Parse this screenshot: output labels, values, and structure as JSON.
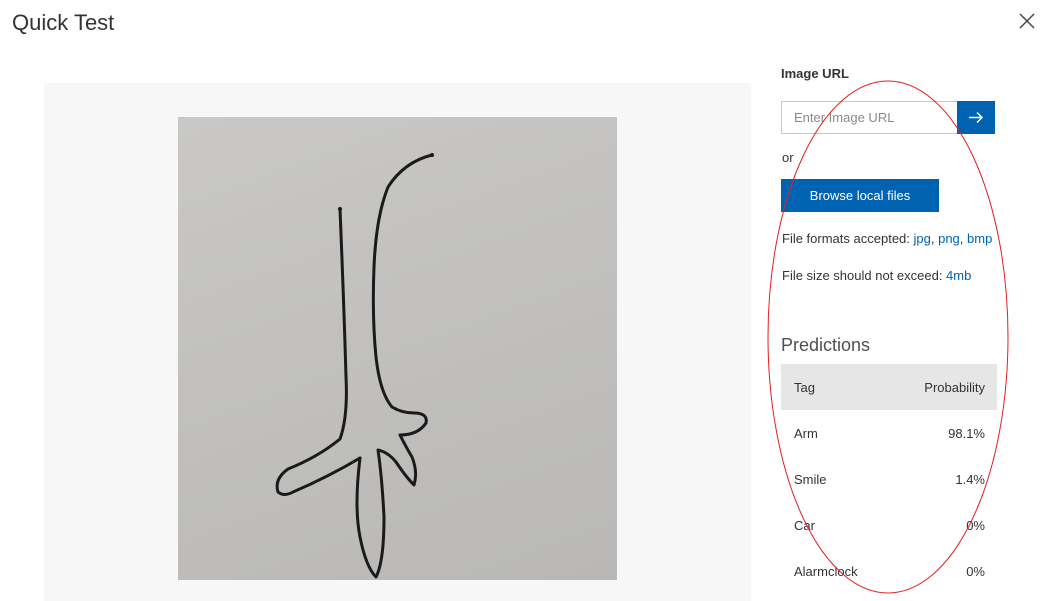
{
  "dialog": {
    "title": "Quick Test",
    "close_icon": "close-icon"
  },
  "image_url": {
    "label": "Image URL",
    "placeholder": "Enter Image URL",
    "submit_icon": "arrow-right-icon"
  },
  "upload": {
    "or_text": "or",
    "browse_label": "Browse local files",
    "formats_prefix": "File formats accepted: ",
    "formats": [
      "jpg",
      "png",
      "bmp"
    ],
    "size_prefix": "File size should not exceed: ",
    "size_limit": "4mb"
  },
  "predictions": {
    "title": "Predictions",
    "columns": [
      "Tag",
      "Probability"
    ],
    "rows": [
      {
        "tag": "Arm",
        "probability": "98.1%"
      },
      {
        "tag": "Smile",
        "probability": "1.4%"
      },
      {
        "tag": "Car",
        "probability": "0%"
      },
      {
        "tag": "Alarmclock",
        "probability": "0%"
      }
    ]
  },
  "colors": {
    "accent": "#0063b1",
    "annotation": "#e02020"
  }
}
